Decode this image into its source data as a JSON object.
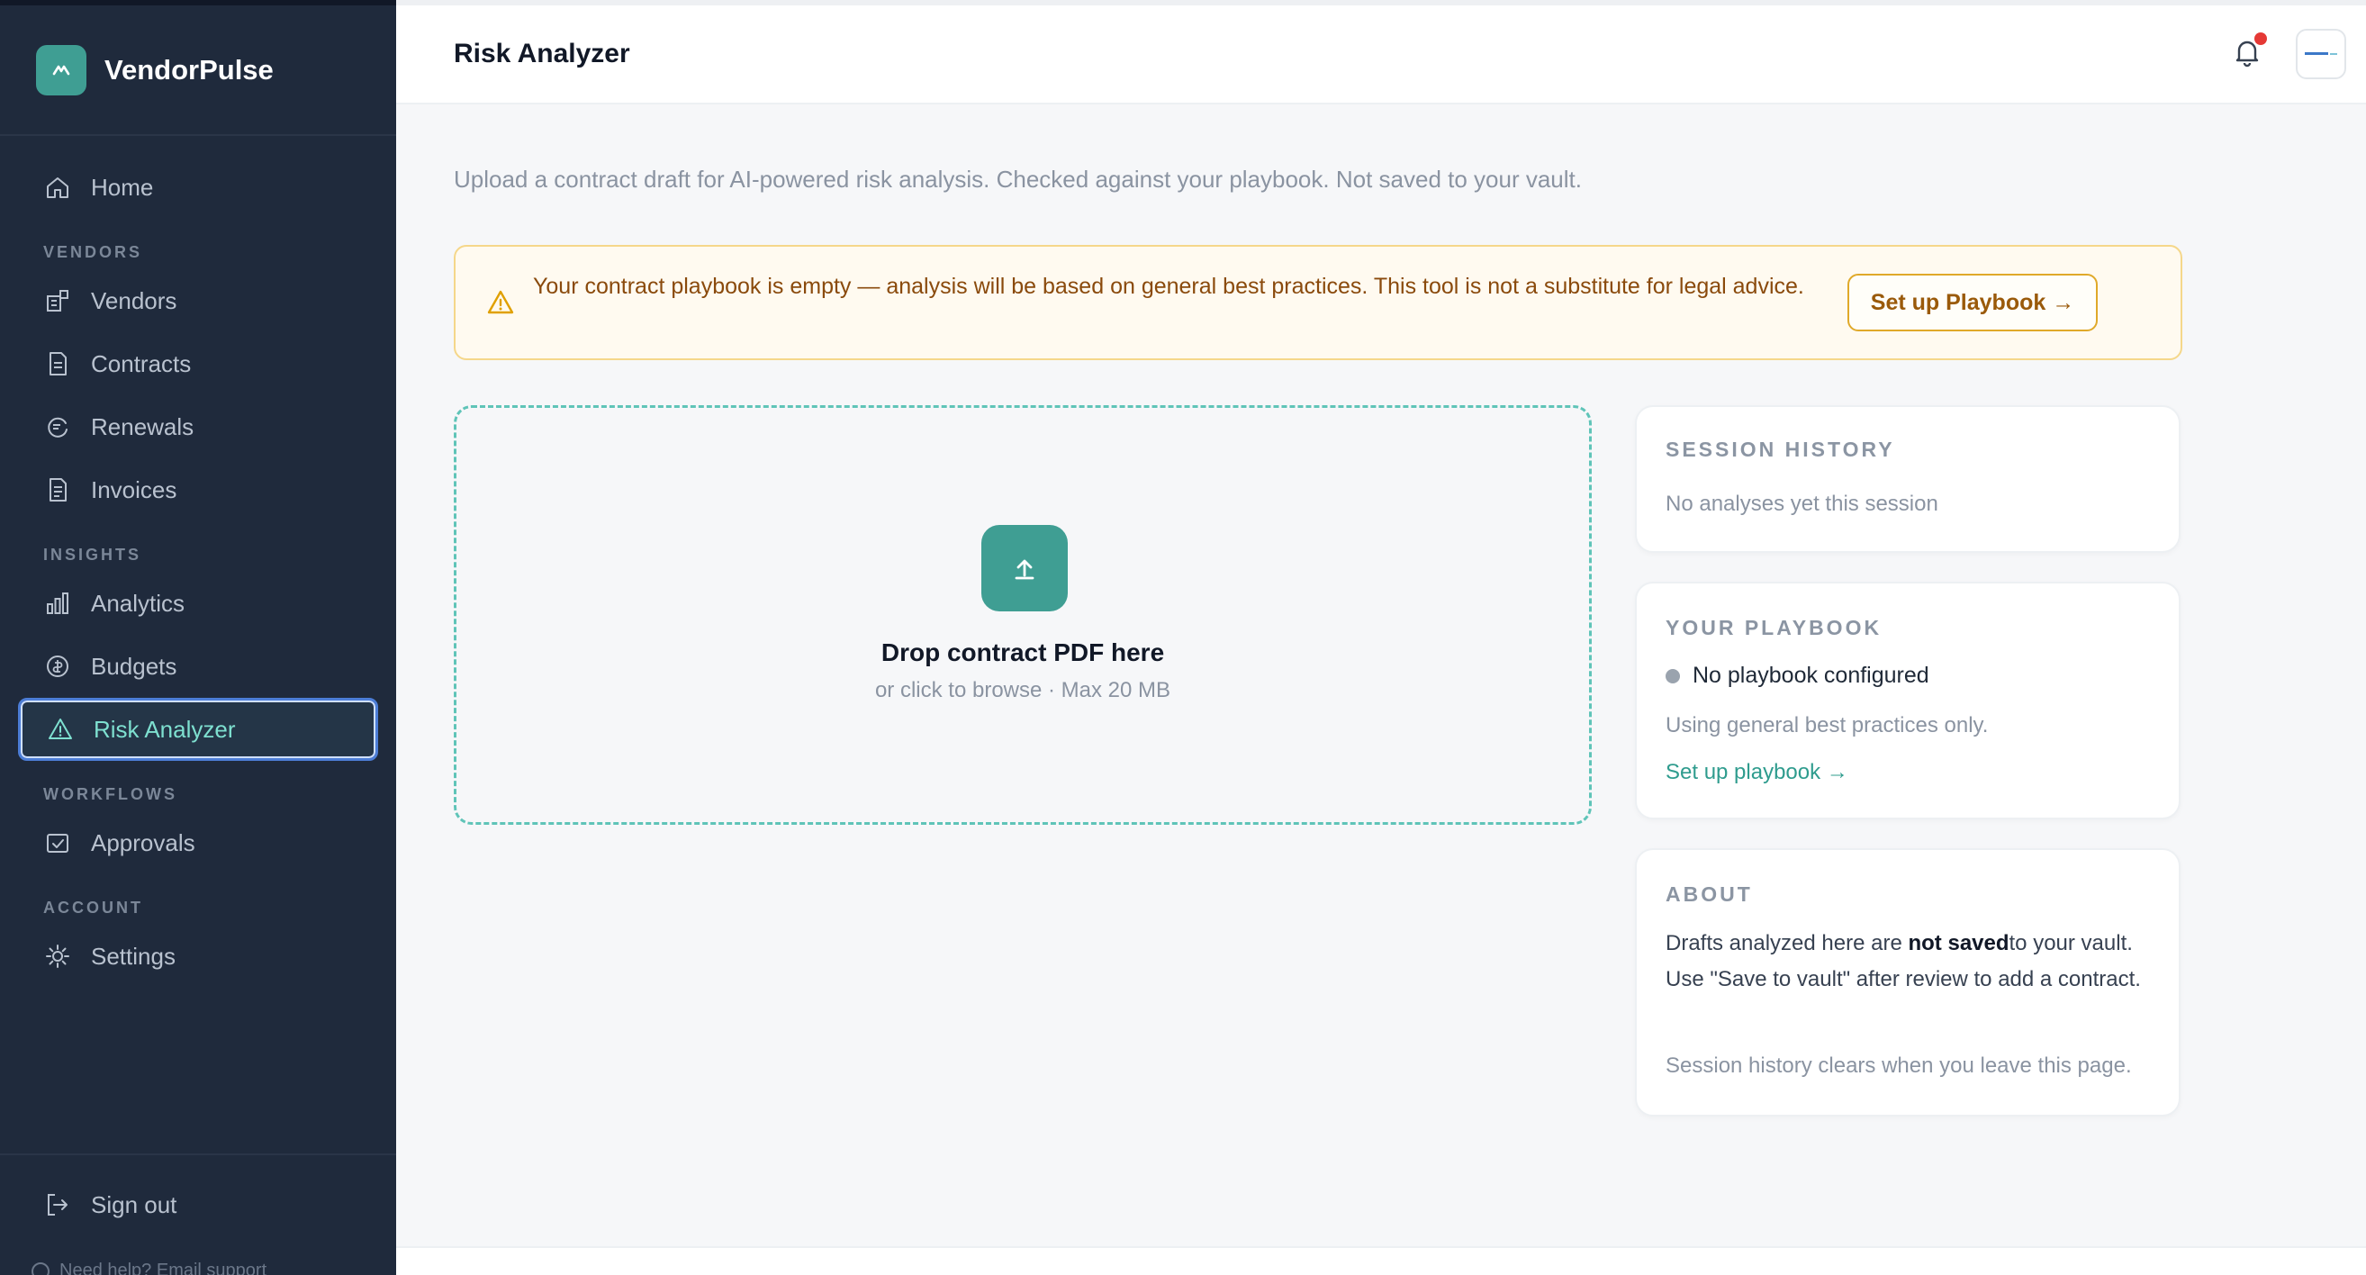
{
  "brand": {
    "name": "VendorPulse"
  },
  "sidebar": {
    "home": "Home",
    "sections": {
      "vendors": "VENDORS",
      "insights": "INSIGHTS",
      "workflows": "WORKFLOWS",
      "account": "ACCOUNT"
    },
    "items": {
      "vendors": "Vendors",
      "contracts": "Contracts",
      "renewals": "Renewals",
      "invoices": "Invoices",
      "analytics": "Analytics",
      "budgets": "Budgets",
      "risk_analyzer": "Risk Analyzer",
      "approvals": "Approvals",
      "settings": "Settings"
    },
    "sign_out": "Sign out",
    "help": "Need help? Email support"
  },
  "header": {
    "title": "Risk Analyzer",
    "has_notification": true
  },
  "main": {
    "subtitle": "Upload a contract draft for AI-powered risk analysis. Checked against your playbook. Not saved to your vault.",
    "warning": {
      "text": "Your contract playbook is empty — analysis will be based on general best practices. This tool is not a substitute for legal advice.",
      "button": "Set up Playbook →"
    },
    "dropzone": {
      "title": "Drop contract PDF here",
      "subtitle": "or click to browse · Max 20 MB"
    }
  },
  "cards": {
    "session": {
      "label": "SESSION HISTORY",
      "empty": "No analyses yet this session"
    },
    "playbook": {
      "label": "YOUR PLAYBOOK",
      "status": "No playbook configured",
      "note": "Using general best practices only.",
      "link": "Set up playbook →"
    },
    "about": {
      "label": "ABOUT",
      "text_before": "Drafts analyzed here are ",
      "text_bold": "not saved",
      "text_after": "to your vault. Use \"Save to vault\" after review to add a contract.",
      "note": "Session history clears when you leave this page."
    }
  },
  "colors": {
    "accent": "#3f9e93",
    "sidebar_bg": "#1f2a3c",
    "warning_bg": "#fffaf0",
    "warning_border": "#f5d78a"
  }
}
